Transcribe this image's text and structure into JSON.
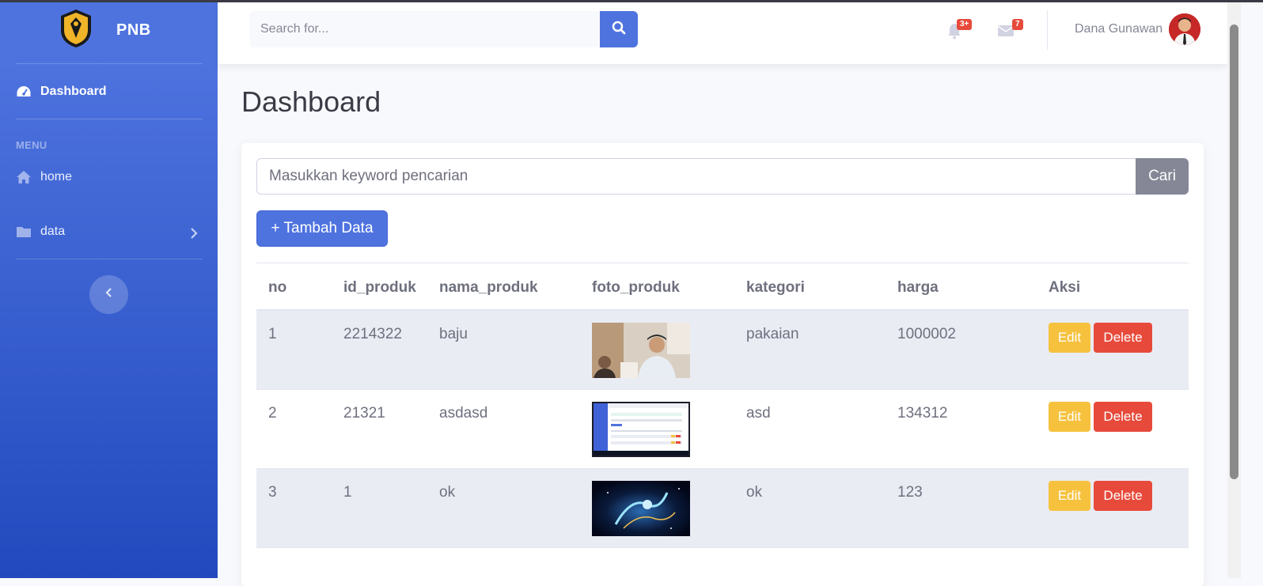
{
  "brand": {
    "name": "PNB"
  },
  "sidebar": {
    "dashboard_label": "Dashboard",
    "heading": "MENU",
    "items": [
      {
        "label": "home",
        "icon": "home-icon"
      },
      {
        "label": "data",
        "icon": "folder-icon"
      }
    ]
  },
  "topbar": {
    "search_placeholder": "Search for...",
    "alerts_badge": "3+",
    "messages_badge": "7",
    "user_name": "Dana Gunawan"
  },
  "page": {
    "title": "Dashboard"
  },
  "filter": {
    "keyword_placeholder": "Masukkan keyword pencarian",
    "search_button": "Cari",
    "add_button": "+ Tambah Data"
  },
  "table": {
    "headers": [
      "no",
      "id_produk",
      "nama_produk",
      "foto_produk",
      "kategori",
      "harga",
      "Aksi"
    ],
    "rows": [
      {
        "no": "1",
        "id_produk": "2214322",
        "nama_produk": "baju",
        "kategori": "pakaian",
        "harga": "1000002"
      },
      {
        "no": "2",
        "id_produk": "21321",
        "nama_produk": "asdasd",
        "kategori": "asd",
        "harga": "134312"
      },
      {
        "no": "3",
        "id_produk": "1",
        "nama_produk": "ok",
        "kategori": "ok",
        "harga": "123"
      }
    ],
    "edit_label": "Edit",
    "delete_label": "Delete"
  },
  "colors": {
    "primary": "#4e73df",
    "warning": "#f6c23e",
    "danger": "#e74a3b",
    "secondary": "#858796"
  }
}
